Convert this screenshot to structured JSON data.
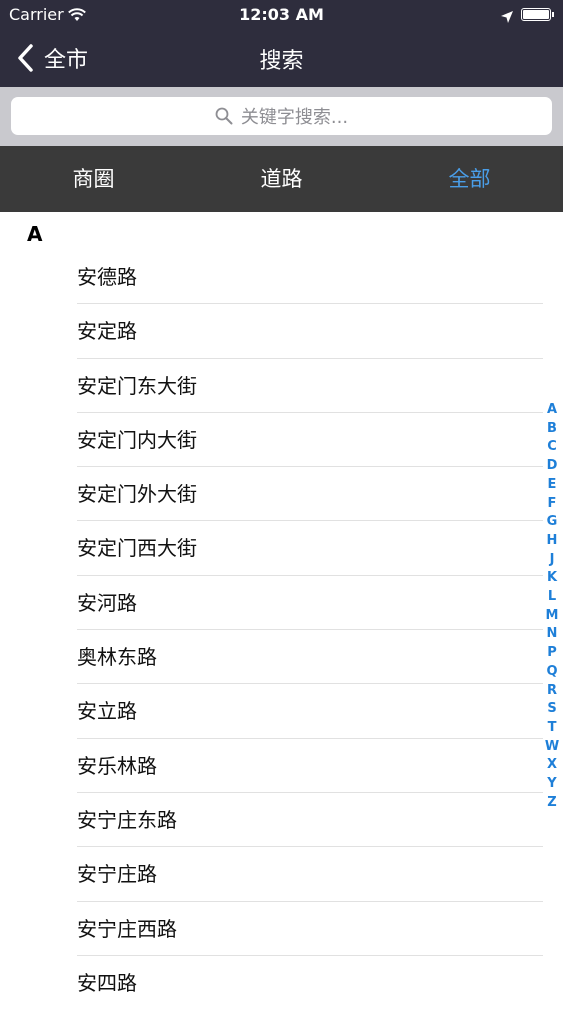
{
  "status_bar": {
    "carrier": "Carrier",
    "time": "12:03 AM"
  },
  "nav": {
    "back_label": "全市",
    "title": "搜索"
  },
  "search": {
    "placeholder": "关键字搜索..."
  },
  "tabs": [
    {
      "label": "商圈",
      "active": false
    },
    {
      "label": "道路",
      "active": false
    },
    {
      "label": "全部",
      "active": true
    }
  ],
  "list": {
    "section": "A",
    "items": [
      "安德路",
      "安定路",
      "安定门东大街",
      "安定门内大街",
      "安定门外大街",
      "安定门西大街",
      "安河路",
      "奥林东路",
      "安立路",
      "安乐林路",
      "安宁庄东路",
      "安宁庄路",
      "安宁庄西路",
      "安四路"
    ]
  },
  "index_letters": [
    "A",
    "B",
    "C",
    "D",
    "E",
    "F",
    "G",
    "H",
    "J",
    "K",
    "L",
    "M",
    "N",
    "P",
    "Q",
    "R",
    "S",
    "T",
    "W",
    "X",
    "Y",
    "Z"
  ],
  "colors": {
    "nav_bg": "#2e2d3d",
    "tab_bg": "#3a3a3a",
    "accent": "#4a9ee8",
    "index": "#1e7fd8"
  }
}
